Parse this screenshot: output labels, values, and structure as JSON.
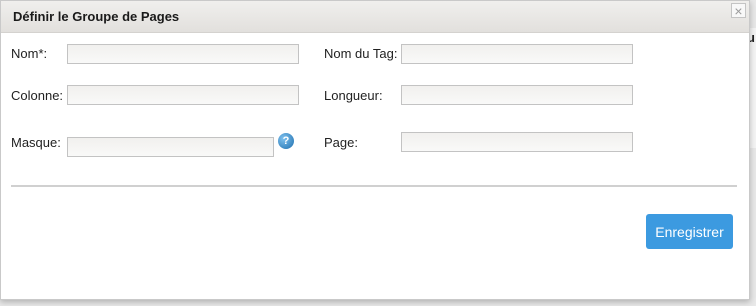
{
  "background": {
    "peek_text": "u"
  },
  "dialog": {
    "title": "Définir le Groupe de Pages",
    "close_symbol": "×"
  },
  "form": {
    "name_label": "Nom*:",
    "name_value": "",
    "tag_label": "Nom du Tag:",
    "tag_value": "",
    "column_label": "Colonne:",
    "column_value": "",
    "length_label": "Longueur:",
    "length_value": "",
    "mask_label": "Masque:",
    "mask_value": "",
    "page_label": "Page:",
    "page_value": "",
    "help_symbol": "?"
  },
  "actions": {
    "save_label": "Enregistrer"
  },
  "colors": {
    "accent": "#3c9ae0",
    "title_bar": "#e6e4e1"
  },
  "icons": {
    "close": "close-icon",
    "help": "help-icon"
  }
}
